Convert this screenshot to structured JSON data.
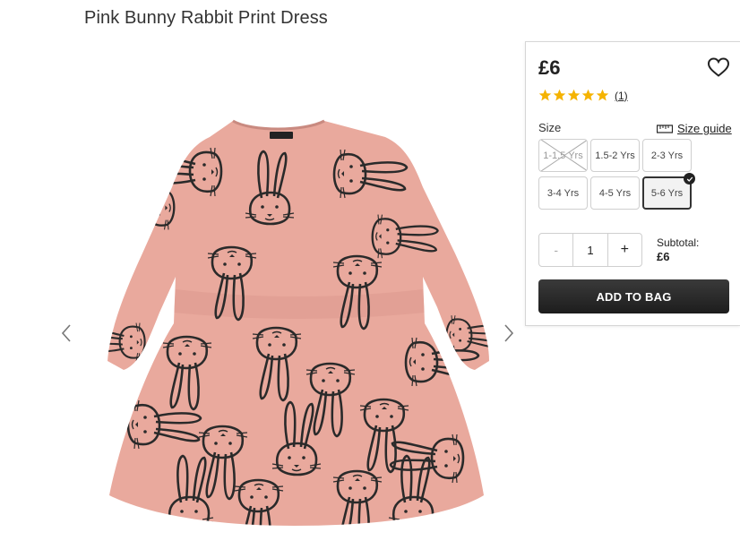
{
  "product": {
    "title": "Pink Bunny Rabbit Print Dress",
    "price": "£6",
    "rating": {
      "stars": 5,
      "max": 5,
      "count_label": "(1)"
    },
    "image_alt": "Pink dress with black bunny rabbit print",
    "colors": {
      "dress": "#e9a99d",
      "print": "#2a2a2a",
      "button": "#262626",
      "star": "#f5b301"
    }
  },
  "sizes": {
    "label": "Size",
    "guide_label": "Size guide",
    "options": [
      {
        "label": "1-1.5 Yrs",
        "available": false,
        "selected": false
      },
      {
        "label": "1.5-2 Yrs",
        "available": true,
        "selected": false
      },
      {
        "label": "2-3 Yrs",
        "available": true,
        "selected": false
      },
      {
        "label": "3-4 Yrs",
        "available": true,
        "selected": false
      },
      {
        "label": "4-5 Yrs",
        "available": true,
        "selected": false
      },
      {
        "label": "5-6 Yrs",
        "available": true,
        "selected": true
      }
    ]
  },
  "quantity": {
    "minus": "-",
    "value": "1",
    "plus": "+"
  },
  "subtotal": {
    "label": "Subtotal:",
    "amount": "£6"
  },
  "actions": {
    "add_to_bag": "ADD TO BAG"
  },
  "icons": {
    "prev": "chevron-left-icon",
    "next": "chevron-right-icon",
    "wishlist": "heart-icon",
    "ruler": "ruler-icon"
  }
}
